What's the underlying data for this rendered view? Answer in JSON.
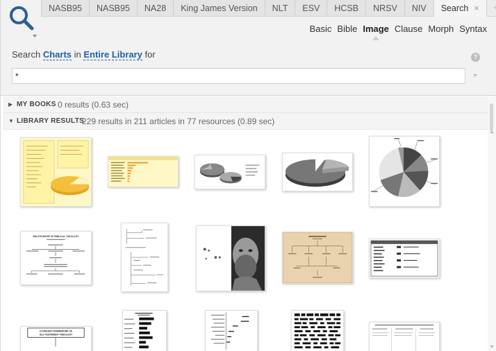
{
  "tabs": [
    {
      "label": "NASB95"
    },
    {
      "label": "NASB95"
    },
    {
      "label": "NA28"
    },
    {
      "label": "King James Version"
    },
    {
      "label": "NLT"
    },
    {
      "label": "ESV"
    },
    {
      "label": "HCSB"
    },
    {
      "label": "NRSV"
    },
    {
      "label": "NIV"
    },
    {
      "label": "Search",
      "close": "×"
    }
  ],
  "add_tab": "+",
  "modes": [
    "Basic",
    "Bible",
    "Image",
    "Clause",
    "Morph",
    "Syntax"
  ],
  "active_mode": "Image",
  "search_line": {
    "prefix": "Search",
    "target": "Charts",
    "in_word": "in",
    "scope": "Entire Library",
    "suffix": "for"
  },
  "help": "?",
  "query": "*",
  "sections": {
    "my_books": {
      "label": "MY BOOKS",
      "summary": "0 results (0.63 sec)"
    },
    "library_results": {
      "label": "LIBRARY RESULTS",
      "summary": "229 results in 211 articles in 77 resources (0.89 sec)"
    }
  },
  "thumbnails": [
    {
      "name": "thumb-yellow-pie-chart"
    },
    {
      "name": "thumb-yellow-bar-table"
    },
    {
      "name": "thumb-exploded-pie-charts"
    },
    {
      "name": "thumb-gray-pie-chart"
    },
    {
      "name": "thumb-labeled-pie-chart"
    },
    {
      "name": "thumb-theology-diagram"
    },
    {
      "name": "thumb-tree-diagram"
    },
    {
      "name": "thumb-portrait-image"
    },
    {
      "name": "thumb-parchment-chart"
    },
    {
      "name": "thumb-comparison-table"
    },
    {
      "name": "thumb-covenant-framework"
    },
    {
      "name": "thumb-dates-bar-chart"
    },
    {
      "name": "thumb-timeline-chart"
    },
    {
      "name": "thumb-dense-grid"
    },
    {
      "name": "thumb-text-document"
    }
  ],
  "thumb_labels": {
    "theology_title": "RELATIONSHIP OF BIBLICAL THEOLOGY",
    "covenant_title": "COVENANT FRAMEWORK OF",
    "covenant_sub": "OLD TESTAMENT THEOLOGY"
  }
}
